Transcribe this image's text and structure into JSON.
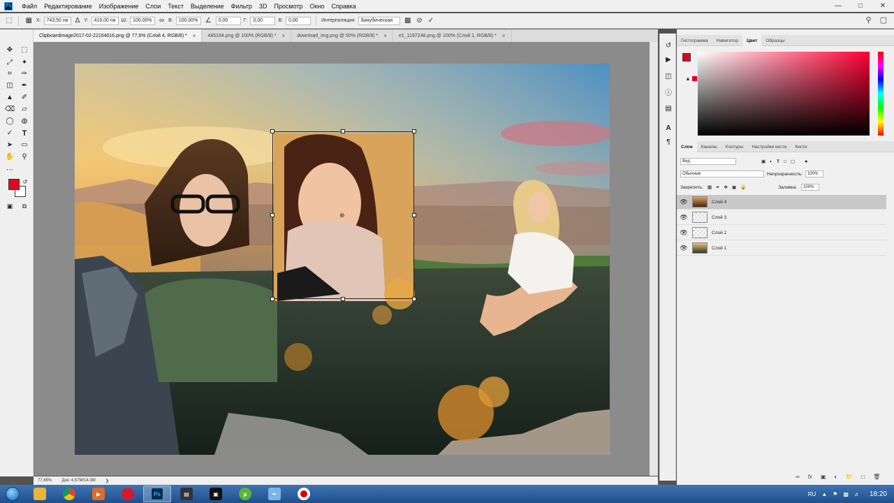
{
  "menu": [
    "Файл",
    "Редактирование",
    "Изображение",
    "Слои",
    "Текст",
    "Выделение",
    "Фильтр",
    "3D",
    "Просмотр",
    "Окно",
    "Справка"
  ],
  "app_logo": "Ps",
  "options": {
    "x_label": "X:",
    "x_value": "743,50 пи",
    "y_value": "419,00 пи",
    "w_label": "Ш:",
    "w_value": "100,00%",
    "h_label": "В:",
    "h_value": "100,00%",
    "angle_value": "0,00",
    "hskew_label": "Г:",
    "hskew_value": "0,00",
    "vskew_label": "В:",
    "vskew_value": "0,00",
    "interp_label": "Интерполяция:",
    "interp_value": "Бикубическая"
  },
  "tabs": [
    {
      "label": "Clipboardimage2017-02-22164016.png @ 77,6% (Слой 4, RGB/8) *",
      "active": true
    },
    {
      "label": "445184.png @ 100% (RGB/8) *",
      "active": false
    },
    {
      "label": "download_img.png @ 50% (RGB/8) *",
      "active": false
    },
    {
      "label": "e1_1197248.png @ 100% (Слой 1, RGB/8) *",
      "active": false
    }
  ],
  "status": {
    "zoom": "77,65%",
    "doc": "Док: 4,57M/14,3M"
  },
  "color_panel": {
    "tabs": [
      "Гистограмма",
      "Навигатор",
      "Цвет",
      "Образцы"
    ],
    "active_tab": "Цвет",
    "foreground": "#e8001c",
    "background": "#ffffff"
  },
  "layers_panel": {
    "tabs": [
      "Слои",
      "Каналы",
      "Контуры",
      "Настройки кисти",
      "Кисти"
    ],
    "active_tab": "Слои",
    "filter_kind": "Вид",
    "blend_mode": "Обычные",
    "opacity_label": "Непрозрачность:",
    "opacity_value": "100%",
    "lock_label": "Закрепить:",
    "fill_label": "Заливка:",
    "fill_value": "100%",
    "layers": [
      {
        "name": "Слой 4",
        "selected": true
      },
      {
        "name": "Слой 3",
        "selected": false
      },
      {
        "name": "Слой 2",
        "selected": false
      },
      {
        "name": "Слой 1",
        "selected": false
      }
    ]
  },
  "taskbar": {
    "lang": "RU",
    "time": "18:20",
    "apps": [
      "explorer-icon",
      "chrome-icon",
      "media-player-icon",
      "opera-icon",
      "photoshop-icon",
      "movie-maker-icon",
      "video-editor-icon",
      "torrent-icon",
      "notes-icon",
      "record-icon"
    ]
  },
  "colors": {
    "accent_red": "#e8001c",
    "canvas_bg": "#8b8b8b",
    "taskbar": "#2a5e9e"
  }
}
